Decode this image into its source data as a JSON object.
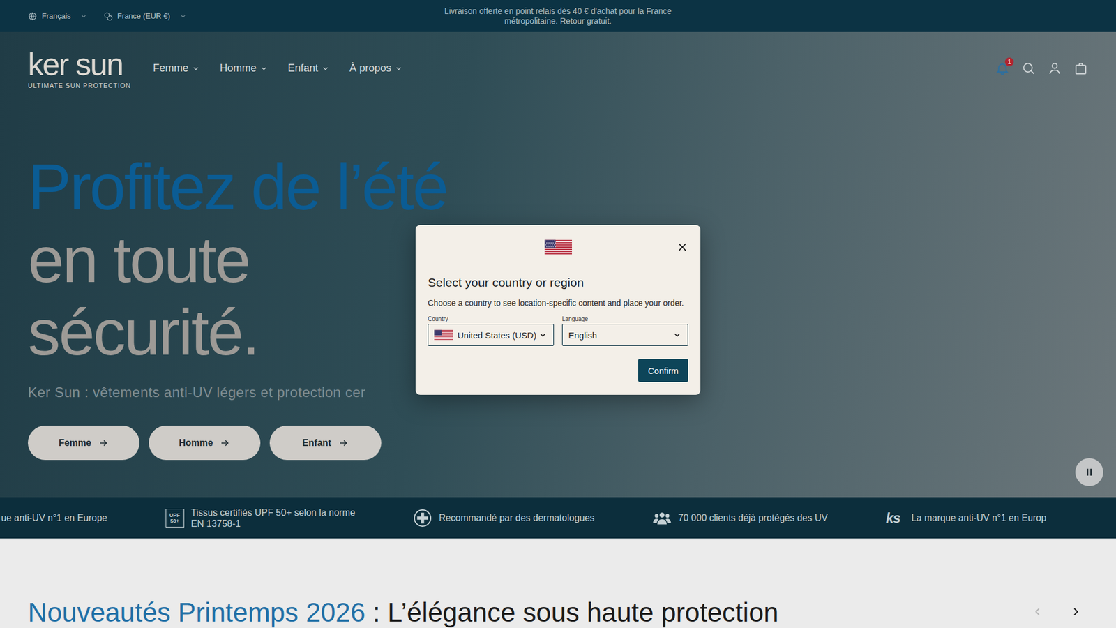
{
  "top_bar": {
    "language": "Français",
    "currency": "France (EUR €)",
    "announcement": [
      "Livraison offerte en point relais dès 40 € d'achat pour la France",
      "métropolitaine. Retour gratuit."
    ]
  },
  "header": {
    "logo": "ker sun",
    "tagline": "ULTIMATE SUN PROTECTION",
    "nav": [
      "Femme",
      "Homme",
      "Enfant",
      "À propos"
    ],
    "notification_count": "1"
  },
  "hero": {
    "title_accent": "Profitez de l’été",
    "title_rest": [
      "en toute",
      "sécurité."
    ],
    "subtitle": "Ker Sun : vêtements anti-UV légers et protection cer",
    "buttons": [
      "Femme",
      "Homme",
      "Enfant"
    ]
  },
  "trust_strip": [
    {
      "kind": "plain",
      "badge": [],
      "lines": [
        "ue anti-UV n°1 en Europe"
      ]
    },
    {
      "kind": "upf",
      "badge": [
        "UPF",
        "50+"
      ],
      "lines": [
        "Tissus certifiés UPF 50+ selon la norme",
        "EN 13758-1"
      ]
    },
    {
      "kind": "cross",
      "badge": [],
      "lines": [
        "Recommandé par des dermatologues"
      ]
    },
    {
      "kind": "people",
      "badge": [],
      "lines": [
        "70 000 clients déjà protégés des UV"
      ]
    },
    {
      "kind": "ks",
      "badge": [
        "ks"
      ],
      "lines": [
        "La marque anti-UV n°1 en Europ"
      ]
    }
  ],
  "section": {
    "title_accent": "Nouveautés Printemps 2026",
    "title_rest": " : L’élégance sous haute protection",
    "prev_disabled": true
  },
  "modal": {
    "title": "Select your country or region",
    "description": "Choose a country to see location-specific content and place your order.",
    "country_label": "Country",
    "country": "United States (USD)",
    "language_label": "Language",
    "language": "English",
    "confirm": "Confirm"
  }
}
